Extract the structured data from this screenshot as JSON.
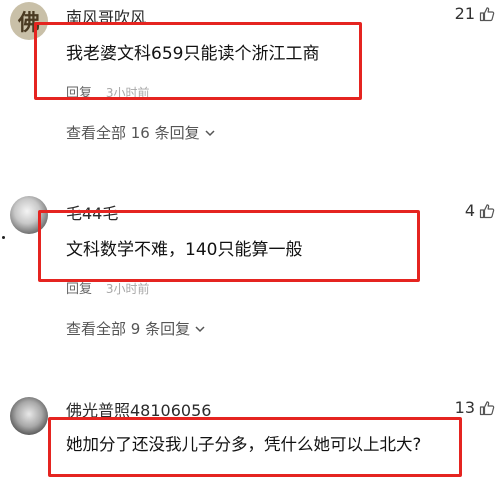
{
  "comments": [
    {
      "username": "南风哥吹风",
      "avatar_text": "佛",
      "likes": "21",
      "content": "我老婆文科659只能读个浙江工商",
      "reply_label": "回复",
      "time": "3小时前",
      "view_all": "查看全部 16 条回复"
    },
    {
      "username": "毛44毛",
      "likes": "4",
      "content": "文科数学不难，140只能算一般",
      "reply_label": "回复",
      "time": "3小时前",
      "view_all": "查看全部 9 条回复"
    },
    {
      "username": "佛光普照48106056",
      "likes": "13",
      "content": "她加分了还没我儿子分多，凭什么她可以上北大?"
    }
  ],
  "colors": {
    "highlight_box": "#e52420",
    "meta_text": "#9a9a9a"
  },
  "icons": {
    "like": "thumbs-up-icon",
    "expand": "chevron-down-icon"
  }
}
